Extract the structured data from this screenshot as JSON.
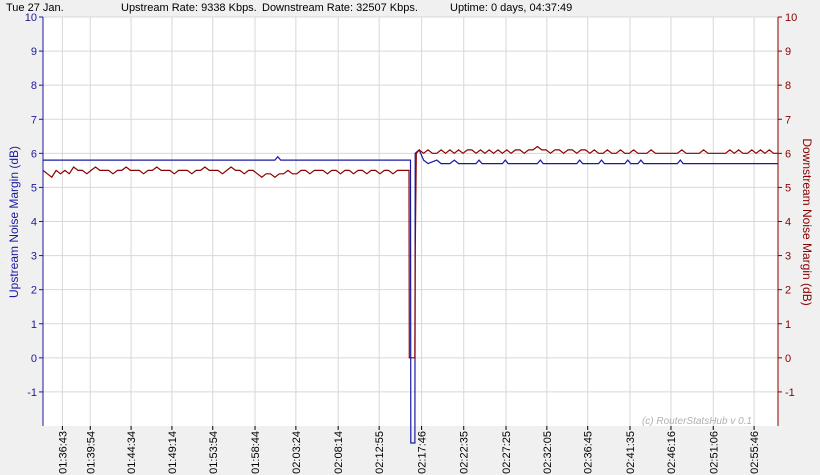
{
  "header": {
    "date": "Tue 27 Jan.",
    "upstream_rate": "Upstream Rate: 9338 Kbps.",
    "downstream_rate": "Downstream Rate: 32507 Kbps.",
    "uptime": "Uptime: 0 days, 04:37:49"
  },
  "watermark": "(c) RouterStatsHub v 0.1",
  "colors": {
    "upstream": "#1a1aa0",
    "downstream": "#8b0000",
    "grid": "#d8d8d8",
    "plot_bg": "#ffffff"
  },
  "chart_data": {
    "type": "line",
    "ylabel_left": "Upstream Noise Margin (dB)",
    "ylabel_right": "Downstream Noise Margin (dB)",
    "ylim": [
      -2,
      10
    ],
    "yticks": [
      -1,
      0,
      1,
      2,
      3,
      4,
      5,
      6,
      7,
      8,
      9,
      10
    ],
    "ytick_labels": [
      "-1",
      "0",
      "1",
      "2",
      "3",
      "4",
      "5",
      "6",
      "7",
      "8",
      "9",
      "10"
    ],
    "xlim": [
      "01:34:30",
      "02:58:30"
    ],
    "x_ticks": [
      "01:36:43",
      "01:39:54",
      "01:44:34",
      "01:49:14",
      "01:53:54",
      "01:58:44",
      "02:03:24",
      "02:08:14",
      "02:12:55",
      "02:17:46",
      "02:22:35",
      "02:27:25",
      "02:32:05",
      "02:36:45",
      "02:41:35",
      "02:46:16",
      "02:51:06",
      "02:55:46"
    ],
    "grid": true,
    "series": [
      {
        "key": "upstream",
        "axis": "left",
        "points": [
          [
            "01:34:30",
            5.8
          ],
          [
            "02:01:00",
            5.8
          ],
          [
            "02:01:20",
            5.9
          ],
          [
            "02:01:40",
            5.8
          ],
          [
            "02:16:30",
            5.8
          ],
          [
            "02:16:32",
            -2.5
          ],
          [
            "02:17:00",
            -2.5
          ],
          [
            "02:17:02",
            6.0
          ],
          [
            "02:17:30",
            6.1
          ],
          [
            "02:18:00",
            5.8
          ],
          [
            "02:18:30",
            5.7
          ],
          [
            "02:19:30",
            5.8
          ],
          [
            "02:20:00",
            5.7
          ],
          [
            "02:21:00",
            5.7
          ],
          [
            "02:21:30",
            5.8
          ],
          [
            "02:22:00",
            5.7
          ],
          [
            "02:24:00",
            5.7
          ],
          [
            "02:24:20",
            5.8
          ],
          [
            "02:24:40",
            5.7
          ],
          [
            "02:27:00",
            5.7
          ],
          [
            "02:27:20",
            5.8
          ],
          [
            "02:27:40",
            5.7
          ],
          [
            "02:31:00",
            5.7
          ],
          [
            "02:31:20",
            5.8
          ],
          [
            "02:31:40",
            5.7
          ],
          [
            "02:35:30",
            5.7
          ],
          [
            "02:35:50",
            5.8
          ],
          [
            "02:36:10",
            5.7
          ],
          [
            "02:38:00",
            5.7
          ],
          [
            "02:38:20",
            5.8
          ],
          [
            "02:38:40",
            5.7
          ],
          [
            "02:41:00",
            5.7
          ],
          [
            "02:41:20",
            5.8
          ],
          [
            "02:41:40",
            5.7
          ],
          [
            "02:42:30",
            5.7
          ],
          [
            "02:42:50",
            5.8
          ],
          [
            "02:43:10",
            5.7
          ],
          [
            "02:47:00",
            5.7
          ],
          [
            "02:47:20",
            5.8
          ],
          [
            "02:47:40",
            5.7
          ],
          [
            "02:58:30",
            5.7
          ]
        ]
      },
      {
        "key": "downstream",
        "axis": "right",
        "points": [
          [
            "01:34:30",
            5.5
          ],
          [
            "01:35:00",
            5.4
          ],
          [
            "01:35:30",
            5.3
          ],
          [
            "01:36:00",
            5.5
          ],
          [
            "01:36:30",
            5.4
          ],
          [
            "01:37:00",
            5.5
          ],
          [
            "01:37:30",
            5.4
          ],
          [
            "01:38:00",
            5.6
          ],
          [
            "01:38:30",
            5.5
          ],
          [
            "01:39:00",
            5.5
          ],
          [
            "01:39:30",
            5.4
          ],
          [
            "01:40:00",
            5.5
          ],
          [
            "01:40:30",
            5.6
          ],
          [
            "01:41:00",
            5.5
          ],
          [
            "01:41:30",
            5.5
          ],
          [
            "01:42:00",
            5.5
          ],
          [
            "01:42:30",
            5.4
          ],
          [
            "01:43:00",
            5.5
          ],
          [
            "01:43:30",
            5.5
          ],
          [
            "01:44:00",
            5.6
          ],
          [
            "01:44:30",
            5.5
          ],
          [
            "01:45:00",
            5.5
          ],
          [
            "01:45:30",
            5.5
          ],
          [
            "01:46:00",
            5.4
          ],
          [
            "01:46:30",
            5.5
          ],
          [
            "01:47:00",
            5.5
          ],
          [
            "01:47:30",
            5.6
          ],
          [
            "01:48:00",
            5.5
          ],
          [
            "01:48:30",
            5.5
          ],
          [
            "01:49:00",
            5.5
          ],
          [
            "01:49:30",
            5.4
          ],
          [
            "01:50:00",
            5.5
          ],
          [
            "01:50:30",
            5.5
          ],
          [
            "01:51:00",
            5.5
          ],
          [
            "01:51:30",
            5.4
          ],
          [
            "01:52:00",
            5.5
          ],
          [
            "01:52:30",
            5.5
          ],
          [
            "01:53:00",
            5.6
          ],
          [
            "01:53:30",
            5.5
          ],
          [
            "01:54:00",
            5.5
          ],
          [
            "01:54:30",
            5.5
          ],
          [
            "01:55:00",
            5.4
          ],
          [
            "01:55:30",
            5.5
          ],
          [
            "01:56:00",
            5.6
          ],
          [
            "01:56:30",
            5.5
          ],
          [
            "01:57:00",
            5.5
          ],
          [
            "01:57:30",
            5.4
          ],
          [
            "01:58:00",
            5.5
          ],
          [
            "01:58:30",
            5.5
          ],
          [
            "01:59:00",
            5.4
          ],
          [
            "01:59:30",
            5.3
          ],
          [
            "02:00:00",
            5.4
          ],
          [
            "02:00:30",
            5.4
          ],
          [
            "02:01:00",
            5.3
          ],
          [
            "02:01:30",
            5.4
          ],
          [
            "02:02:00",
            5.4
          ],
          [
            "02:02:30",
            5.5
          ],
          [
            "02:03:00",
            5.4
          ],
          [
            "02:03:30",
            5.4
          ],
          [
            "02:04:00",
            5.5
          ],
          [
            "02:04:30",
            5.5
          ],
          [
            "02:05:00",
            5.4
          ],
          [
            "02:05:30",
            5.5
          ],
          [
            "02:06:00",
            5.5
          ],
          [
            "02:06:30",
            5.5
          ],
          [
            "02:07:00",
            5.4
          ],
          [
            "02:07:30",
            5.5
          ],
          [
            "02:08:00",
            5.5
          ],
          [
            "02:08:30",
            5.4
          ],
          [
            "02:09:00",
            5.5
          ],
          [
            "02:09:30",
            5.5
          ],
          [
            "02:10:00",
            5.4
          ],
          [
            "02:10:30",
            5.5
          ],
          [
            "02:11:00",
            5.5
          ],
          [
            "02:11:30",
            5.4
          ],
          [
            "02:12:00",
            5.5
          ],
          [
            "02:12:30",
            5.5
          ],
          [
            "02:13:00",
            5.4
          ],
          [
            "02:13:30",
            5.5
          ],
          [
            "02:14:00",
            5.5
          ],
          [
            "02:14:30",
            5.4
          ],
          [
            "02:15:00",
            5.5
          ],
          [
            "02:15:30",
            5.5
          ],
          [
            "02:16:00",
            5.5
          ],
          [
            "02:16:20",
            5.5
          ],
          [
            "02:16:22",
            0.0
          ],
          [
            "02:17:00",
            0.0
          ],
          [
            "02:17:02",
            3.0
          ],
          [
            "02:17:10",
            6.0
          ],
          [
            "02:17:30",
            6.1
          ],
          [
            "02:18:00",
            6.0
          ],
          [
            "02:18:30",
            6.1
          ],
          [
            "02:19:00",
            6.0
          ],
          [
            "02:19:30",
            6.0
          ],
          [
            "02:20:00",
            6.1
          ],
          [
            "02:20:30",
            6.0
          ],
          [
            "02:21:00",
            6.1
          ],
          [
            "02:21:30",
            6.0
          ],
          [
            "02:22:00",
            6.1
          ],
          [
            "02:22:30",
            6.0
          ],
          [
            "02:23:00",
            6.1
          ],
          [
            "02:23:30",
            6.1
          ],
          [
            "02:24:00",
            6.0
          ],
          [
            "02:24:30",
            6.1
          ],
          [
            "02:25:00",
            6.0
          ],
          [
            "02:25:30",
            6.1
          ],
          [
            "02:26:00",
            6.0
          ],
          [
            "02:26:30",
            6.1
          ],
          [
            "02:27:00",
            6.0
          ],
          [
            "02:27:30",
            6.1
          ],
          [
            "02:28:00",
            6.0
          ],
          [
            "02:28:30",
            6.1
          ],
          [
            "02:29:00",
            6.1
          ],
          [
            "02:29:30",
            6.0
          ],
          [
            "02:30:00",
            6.1
          ],
          [
            "02:30:30",
            6.1
          ],
          [
            "02:31:00",
            6.2
          ],
          [
            "02:31:30",
            6.1
          ],
          [
            "02:32:00",
            6.1
          ],
          [
            "02:32:30",
            6.0
          ],
          [
            "02:33:00",
            6.1
          ],
          [
            "02:33:30",
            6.1
          ],
          [
            "02:34:00",
            6.0
          ],
          [
            "02:34:30",
            6.1
          ],
          [
            "02:35:00",
            6.1
          ],
          [
            "02:35:30",
            6.0
          ],
          [
            "02:36:00",
            6.1
          ],
          [
            "02:36:30",
            6.1
          ],
          [
            "02:37:00",
            6.0
          ],
          [
            "02:37:30",
            6.1
          ],
          [
            "02:38:00",
            6.0
          ],
          [
            "02:38:30",
            6.0
          ],
          [
            "02:39:00",
            6.1
          ],
          [
            "02:39:30",
            6.0
          ],
          [
            "02:40:00",
            6.0
          ],
          [
            "02:40:30",
            6.1
          ],
          [
            "02:41:00",
            6.0
          ],
          [
            "02:41:30",
            6.0
          ],
          [
            "02:42:00",
            6.1
          ],
          [
            "02:42:30",
            6.0
          ],
          [
            "02:43:00",
            6.0
          ],
          [
            "02:43:30",
            6.0
          ],
          [
            "02:44:00",
            6.1
          ],
          [
            "02:44:30",
            6.0
          ],
          [
            "02:45:00",
            6.0
          ],
          [
            "02:45:30",
            6.0
          ],
          [
            "02:46:00",
            6.0
          ],
          [
            "02:46:30",
            6.0
          ],
          [
            "02:47:00",
            6.0
          ],
          [
            "02:47:30",
            6.1
          ],
          [
            "02:48:00",
            6.0
          ],
          [
            "02:48:30",
            6.0
          ],
          [
            "02:49:00",
            6.0
          ],
          [
            "02:49:30",
            6.0
          ],
          [
            "02:50:00",
            6.1
          ],
          [
            "02:50:30",
            6.0
          ],
          [
            "02:51:00",
            6.0
          ],
          [
            "02:51:30",
            6.0
          ],
          [
            "02:52:00",
            6.0
          ],
          [
            "02:52:30",
            6.0
          ],
          [
            "02:53:00",
            6.1
          ],
          [
            "02:53:30",
            6.0
          ],
          [
            "02:54:00",
            6.1
          ],
          [
            "02:54:30",
            6.0
          ],
          [
            "02:55:00",
            6.0
          ],
          [
            "02:55:30",
            6.1
          ],
          [
            "02:56:00",
            6.0
          ],
          [
            "02:56:30",
            6.1
          ],
          [
            "02:57:00",
            6.0
          ],
          [
            "02:57:30",
            6.1
          ],
          [
            "02:58:00",
            6.0
          ],
          [
            "02:58:30",
            6.0
          ]
        ]
      }
    ]
  }
}
